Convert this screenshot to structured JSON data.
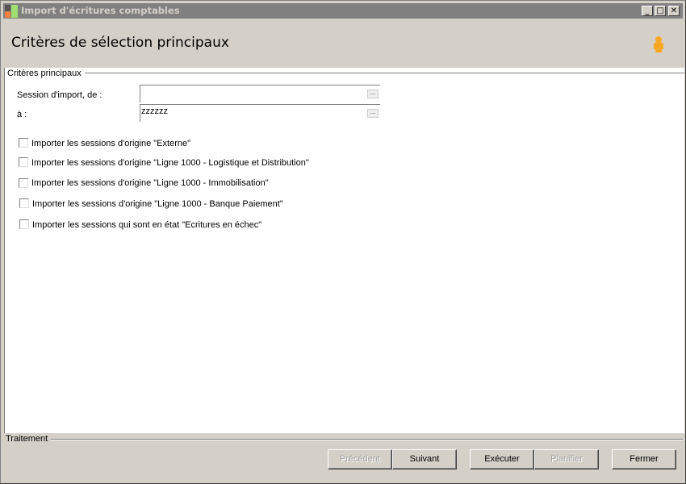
{
  "window": {
    "title": "Import d'écritures comptables",
    "minimize": "_",
    "maximize": "□",
    "close": "✕"
  },
  "header": {
    "title": "Critères de sélection principaux",
    "icon": "person-icon"
  },
  "group": {
    "label": "Critères principaux"
  },
  "fields": {
    "from_label": "Session d'import, de :",
    "from_value": "",
    "to_label": "à :",
    "to_value": "zzzzzz",
    "browse": "..."
  },
  "checkboxes": [
    {
      "label": "Importer les sessions d'origine \"Externe\"",
      "checked": false
    },
    {
      "label": "Importer les sessions d'origine \"Ligne 1000 - Logistique et Distribution\"",
      "checked": false
    },
    {
      "label": "Importer les sessions d'origine \"Ligne 1000 - Immobilisation\"",
      "checked": false
    },
    {
      "label": "Importer les sessions d'origine \"Ligne 1000 - Banque Paiement\"",
      "checked": false
    },
    {
      "label": "Importer les sessions qui sont en état \"Ecritures en échec\"",
      "checked": false
    }
  ],
  "footer": {
    "label": "Traitement",
    "buttons": {
      "previous": "Précédent",
      "next": "Suivant",
      "execute": "Exécuter",
      "schedule": "Planifier",
      "close": "Fermer"
    }
  }
}
